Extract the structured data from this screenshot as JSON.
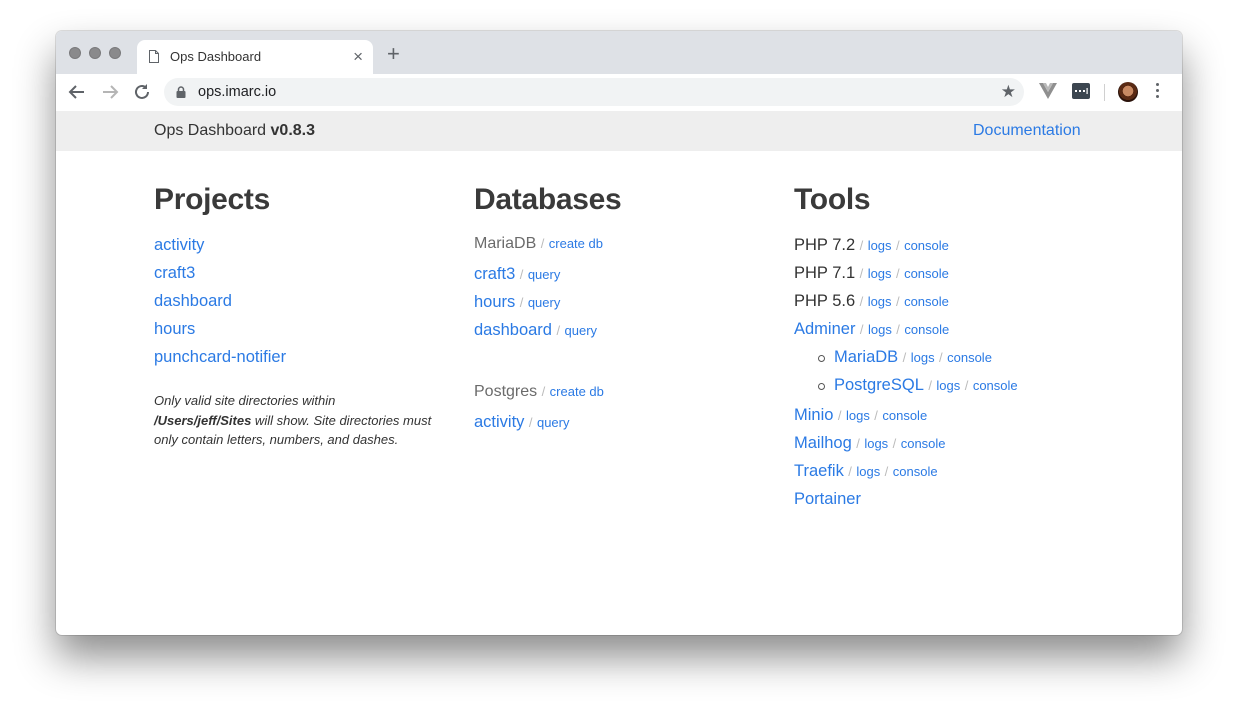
{
  "browser": {
    "tab_title": "Ops Dashboard",
    "url": "ops.imarc.io",
    "icons": [
      "back-arrow-icon",
      "forward-arrow-icon",
      "reload-icon",
      "lock-icon",
      "star-icon",
      "vue-devtools-icon",
      "extension-icon",
      "profile-avatar",
      "kebab-menu-icon"
    ]
  },
  "header": {
    "brand": "Ops Dashboard",
    "version": "v0.8.3",
    "docs_link": "Documentation"
  },
  "separator": "/",
  "projects": {
    "title": "Projects",
    "items": [
      "activity",
      "craft3",
      "dashboard",
      "hours",
      "punchcard-notifier"
    ],
    "note_line1": "Only valid site directories within",
    "note_path": "/Users/jeff/Sites",
    "note_rest": " will show. Site directories must only contain letters, numbers, and dashes."
  },
  "databases": {
    "title": "Databases",
    "groups": [
      {
        "name": "MariaDB",
        "action": "create db",
        "dbs": [
          {
            "name": "craft3",
            "action": "query"
          },
          {
            "name": "hours",
            "action": "query"
          },
          {
            "name": "dashboard",
            "action": "query"
          }
        ]
      },
      {
        "name": "Postgres",
        "action": "create db",
        "dbs": [
          {
            "name": "activity",
            "action": "query"
          }
        ]
      }
    ]
  },
  "tools": {
    "title": "Tools",
    "items": [
      {
        "name": "PHP 7.2",
        "link": false,
        "logs": "logs",
        "console": "console"
      },
      {
        "name": "PHP 7.1",
        "link": false,
        "logs": "logs",
        "console": "console"
      },
      {
        "name": "PHP 5.6",
        "link": false,
        "logs": "logs",
        "console": "console"
      },
      {
        "name": "Adminer",
        "link": true,
        "logs": "logs",
        "console": "console"
      },
      {
        "name": "MariaDB",
        "link": true,
        "logs": "logs",
        "console": "console",
        "sub": true
      },
      {
        "name": "PostgreSQL",
        "link": true,
        "logs": "logs",
        "console": "console",
        "sub": true
      },
      {
        "name": "Minio",
        "link": true,
        "logs": "logs",
        "console": "console"
      },
      {
        "name": "Mailhog",
        "link": true,
        "logs": "logs",
        "console": "console"
      },
      {
        "name": "Traefik",
        "link": true,
        "logs": "logs",
        "console": "console"
      },
      {
        "name": "Portainer",
        "link": true
      }
    ]
  },
  "colors": {
    "link": "#2b7ae4",
    "text": "#333333",
    "appbar_bg": "#eeeeee"
  }
}
